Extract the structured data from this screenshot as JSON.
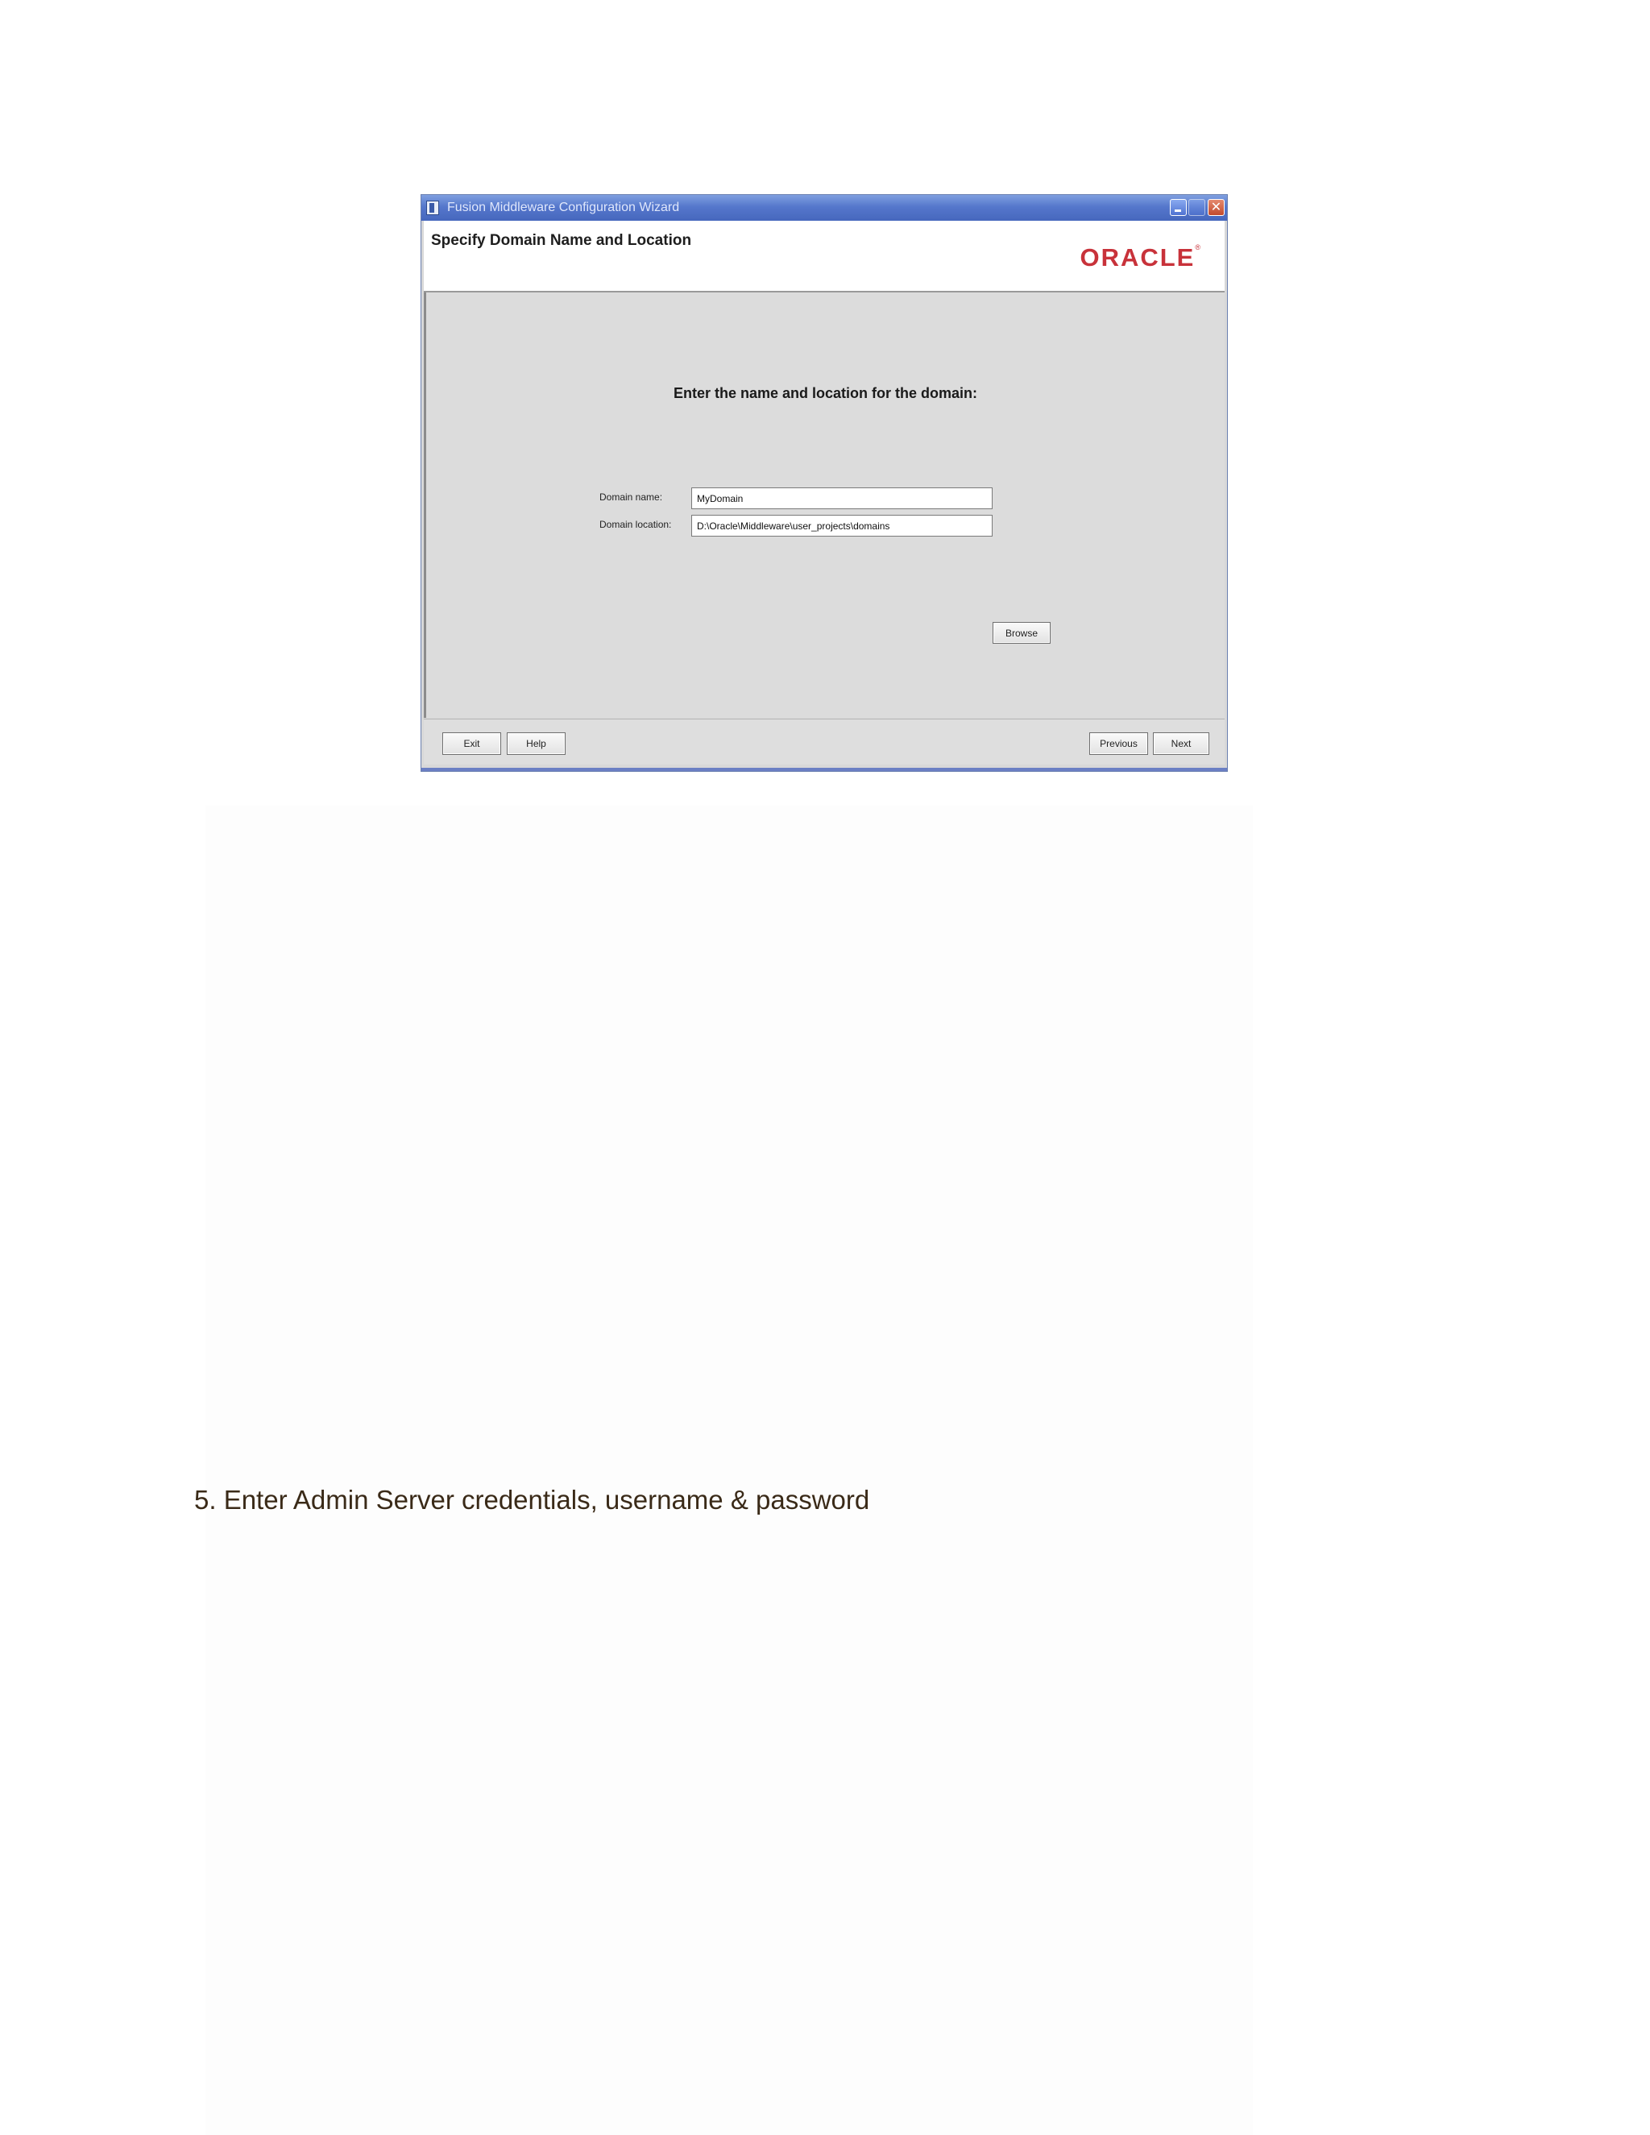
{
  "window": {
    "title": "Fusion Middleware Configuration Wizard",
    "close_glyph": "✕"
  },
  "header": {
    "page_title": "Specify Domain Name and Location",
    "logo_text": "ORACLE",
    "logo_mark": "®"
  },
  "content": {
    "instruction": "Enter the name and location for the domain:",
    "domain_name_label": "Domain name:",
    "domain_name_value": "MyDomain",
    "domain_location_label": "Domain location:",
    "domain_location_value": "D:\\Oracle\\Middleware\\user_projects\\domains",
    "browse_label": "Browse"
  },
  "footer": {
    "exit_label": "Exit",
    "help_label": "Help",
    "previous_label": "Previous",
    "next_label": "Next"
  },
  "document": {
    "step_text": "5. Enter Admin Server credentials, username & password"
  },
  "colors": {
    "titlebar": "#4667bd",
    "logo_red": "#c8323a",
    "panel_gray": "#dcdcdc",
    "step_text": "#3a2a18"
  }
}
